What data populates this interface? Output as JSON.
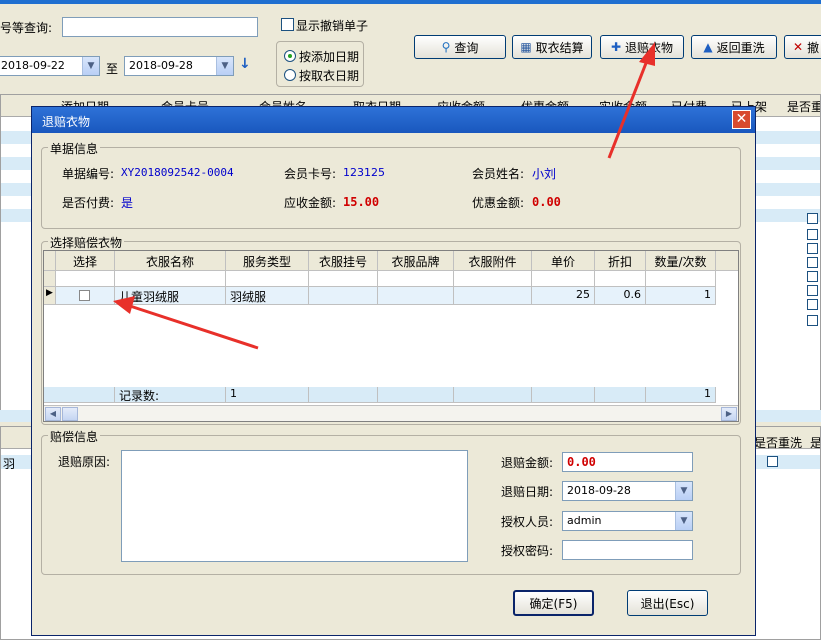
{
  "toolbar": {
    "search_label": "号等查询:",
    "search_value": "",
    "show_cancelled_label": "显示撤销单子",
    "date_from": "2018-09-22",
    "to_label": "至",
    "date_to": "2018-09-28",
    "radio_add_date": "按添加日期",
    "radio_take_date": "按取衣日期",
    "btn_query": "查询",
    "btn_checkout": "取衣结算",
    "btn_refund": "退赔衣物",
    "btn_rewash": "返回重洗",
    "btn_cancel": "撤"
  },
  "bg_grid": {
    "headers": [
      "添加日期",
      "会员卡号",
      "会员姓名",
      "取衣日期",
      "应收金额",
      "优惠金额",
      "实收金额",
      "已付费",
      "已上架",
      "是否重"
    ],
    "lower_headers": [
      "是否重洗",
      "是"
    ],
    "lower_row_text": "羽"
  },
  "dialog": {
    "title": "退赔衣物",
    "close_glyph": "✕",
    "info_group_title": "单据信息",
    "order_no_label": "单据编号:",
    "order_no": "XY2018092542-0004",
    "card_no_label": "会员卡号:",
    "card_no": "123125",
    "member_name_label": "会员姓名:",
    "member_name": "小刘",
    "paid_label": "是否付费:",
    "paid": "是",
    "receivable_label": "应收金额:",
    "receivable": "15.00",
    "discount_label": "优惠金额:",
    "discount": "0.00",
    "select_group_title": "选择赔偿衣物",
    "grid_headers": [
      "选择",
      "衣服名称",
      "服务类型",
      "衣服挂号",
      "衣服品牌",
      "衣服附件",
      "单价",
      "折扣",
      "数量/次数"
    ],
    "grid_row": {
      "name": "儿童羽绒服",
      "service": "羽绒服",
      "tag": "",
      "brand": "",
      "attach": "",
      "price": "25",
      "discount": "0.6",
      "qty": "1"
    },
    "footer_label": "记录数:",
    "footer_count": "1",
    "footer_qty": "1",
    "comp_group_title": "赔偿信息",
    "reason_label": "退赔原因:",
    "reason_value": "",
    "refund_amount_label": "退赔金额:",
    "refund_amount": "0.00",
    "refund_date_label": "退赔日期:",
    "refund_date": "2018-09-28",
    "authorizer_label": "授权人员:",
    "authorizer": "admin",
    "auth_password_label": "授权密码:",
    "auth_password": "",
    "btn_ok": "确定(F5)",
    "btn_exit": "退出(Esc)"
  }
}
